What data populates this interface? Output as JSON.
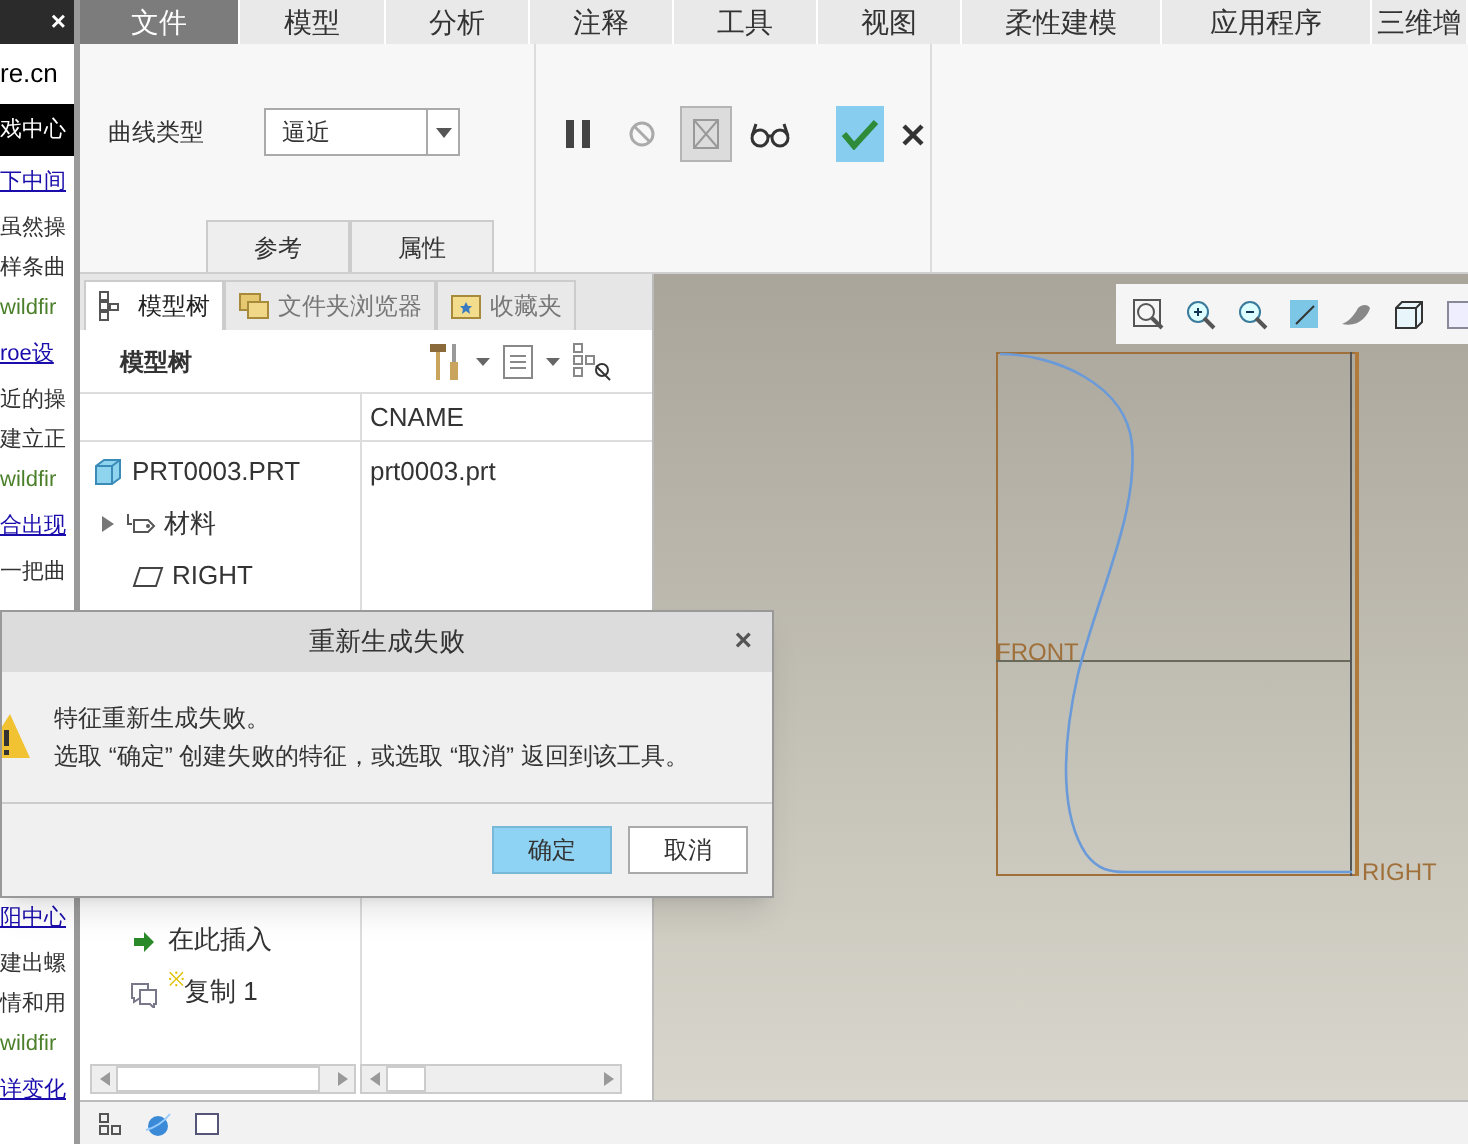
{
  "background_page": {
    "close": "×",
    "address": "re.cn",
    "banner": "戏中心",
    "lines": [
      {
        "text": "下中间",
        "kind": "link"
      },
      {
        "text": "虽然操",
        "kind": "text"
      },
      {
        "text": "样条曲",
        "kind": "text"
      },
      {
        "text": "wildfir",
        "kind": "url"
      },
      {
        "text": "roe设",
        "kind": "link"
      },
      {
        "text": "近的操",
        "kind": "text"
      },
      {
        "text": "建立正",
        "kind": "text"
      },
      {
        "text": "wildfir",
        "kind": "url"
      },
      {
        "text": "合出现",
        "kind": "link"
      },
      {
        "text": "一把曲",
        "kind": "text"
      }
    ],
    "lines_below_dialog": [
      {
        "text": "阳中心",
        "kind": "link"
      },
      {
        "text": "建出螺",
        "kind": "text"
      },
      {
        "text": "情和用",
        "kind": "text"
      },
      {
        "text": "wildfir",
        "kind": "url"
      },
      {
        "text": "详变化",
        "kind": "link"
      }
    ]
  },
  "ribbon": {
    "tabs": [
      {
        "label": "文件",
        "selected": true
      },
      {
        "label": "模型",
        "selected": false
      },
      {
        "label": "分析",
        "selected": false
      },
      {
        "label": "注释",
        "selected": false
      },
      {
        "label": "工具",
        "selected": false
      },
      {
        "label": "视图",
        "selected": false
      },
      {
        "label": "柔性建模",
        "selected": false
      },
      {
        "label": "应用程序",
        "selected": false
      },
      {
        "label": "三维增",
        "selected": false
      }
    ],
    "curve_type": {
      "label": "曲线类型",
      "value": "逼近"
    },
    "tools": [
      {
        "kind": "pause",
        "pressed": false
      },
      {
        "kind": "stop",
        "pressed": false
      },
      {
        "kind": "preview",
        "pressed": true
      },
      {
        "kind": "glasses",
        "pressed": false
      }
    ],
    "panel_tabs": [
      {
        "label": "参考",
        "selected": false
      },
      {
        "label": "属性",
        "selected": false
      }
    ]
  },
  "model_tree": {
    "tabs": [
      {
        "label": "模型树",
        "kind": "tree",
        "selected": true
      },
      {
        "label": "文件夹浏览器",
        "kind": "folder",
        "selected": false
      },
      {
        "label": "收藏夹",
        "kind": "favorites",
        "selected": false
      }
    ],
    "title": "模型树",
    "columns": [
      "CNAME"
    ],
    "rows": [
      {
        "kind": "part",
        "name": "PRT0003.PRT",
        "cname": "prt0003.prt"
      },
      {
        "kind": "material",
        "name": "材料",
        "expanded": false
      },
      {
        "kind": "plane",
        "name": "RIGHT"
      }
    ],
    "rows_below_dialog": [
      {
        "kind": "insert",
        "name": "在此插入"
      },
      {
        "kind": "copy",
        "mark": "※",
        "name": "复制 1"
      }
    ]
  },
  "canvas": {
    "labels": [
      {
        "text": "FRONT",
        "kind": "front"
      },
      {
        "text": "RIGHT",
        "kind": "right"
      }
    ]
  },
  "dialog": {
    "title": "重新生成失败",
    "close": "×",
    "message": [
      "特征重新生成失败。",
      "选取 “确定” 创建失败的特征，或选取 “取消” 返回到该工具。"
    ],
    "buttons": [
      {
        "label": "确定",
        "default": true
      },
      {
        "label": "取消",
        "default": false
      }
    ]
  }
}
